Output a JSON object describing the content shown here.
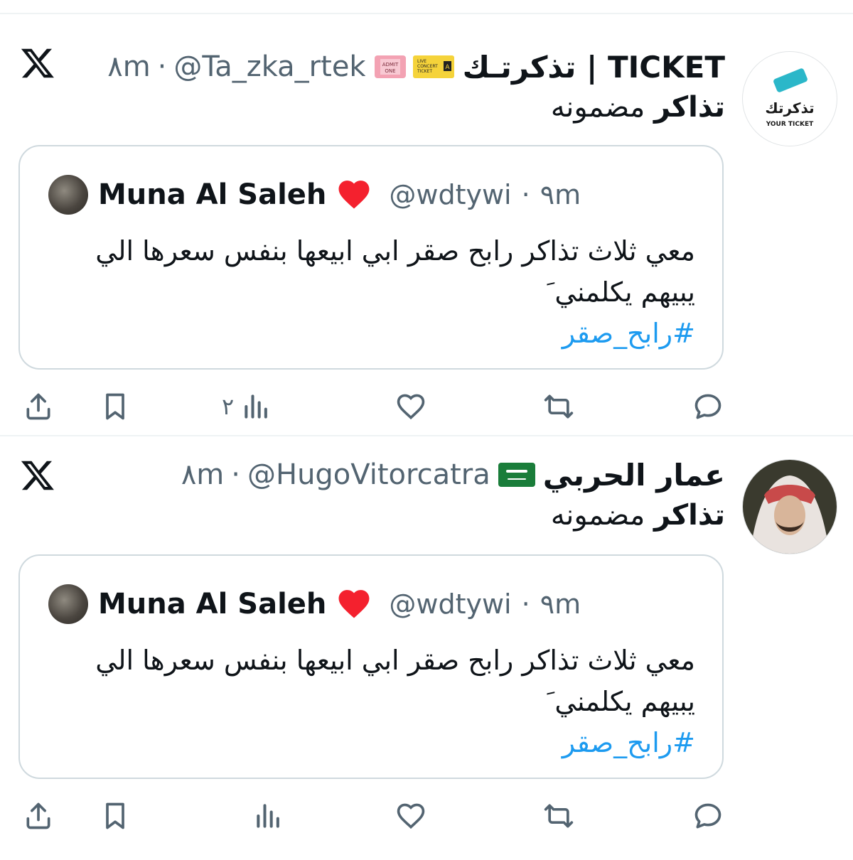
{
  "tweets": [
    {
      "author_name": "تذكرتـك | TICKET",
      "author_handle": "@Ta_zka_rtek",
      "time": "٨m",
      "badges": [
        "admit-one-ticket-emoji",
        "live-concert-ticket-emoji"
      ],
      "text_bold": "تذاكر",
      "text_rest": " مضمونه",
      "avatar_logo_text": "تذكرتك",
      "avatar_logo_sub": "YOUR TICKET",
      "quote": {
        "author_name": "Muna Al Saleh",
        "author_handle": "@wdtywi",
        "time": "٩m",
        "line1": "معي ثلاث تذاكر رابح صقر ابي ابيعها بنفس سعرها الي",
        "line2": "يبيهم يكلمني َ",
        "hashtag": "#رابح_صقر"
      },
      "views": "٢"
    },
    {
      "author_name": "عمار الحربي",
      "author_handle": "@HugoVitorcatra",
      "time": "٨m",
      "badges": [
        "saudi-flag-emoji"
      ],
      "text_bold": "تذاكر",
      "text_rest": " مضمونه",
      "quote": {
        "author_name": "Muna Al Saleh",
        "author_handle": "@wdtywi",
        "time": "٩m",
        "line1": "معي ثلاث تذاكر رابح صقر ابي ابيعها بنفس سعرها الي",
        "line2": "يبيهم يكلمني َ",
        "hashtag": "#رابح_صقر"
      },
      "views": ""
    }
  ],
  "separator": "·",
  "colors": {
    "text": "#0f1419",
    "muted": "#536471",
    "link": "#1d9bf0",
    "border": "#cfd9de",
    "heart": "#f4212e"
  }
}
